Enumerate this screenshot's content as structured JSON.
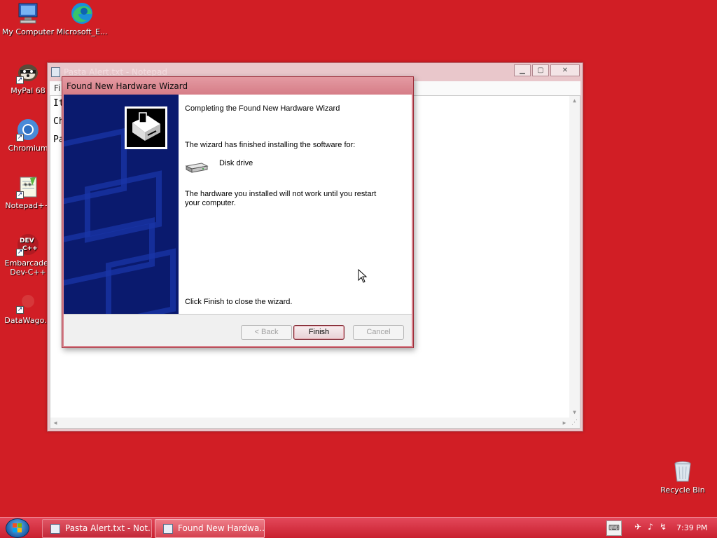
{
  "desktop": {
    "background": "#d11e25",
    "icons": [
      {
        "label": "My Computer",
        "icon": "computer-icon"
      },
      {
        "label": "Microsoft_E...",
        "icon": "edge-icon"
      },
      {
        "label": "MyPal 68",
        "icon": "mypal-icon"
      },
      {
        "label": "Chromium",
        "icon": "chromium-icon"
      },
      {
        "label": "Notepad++",
        "icon": "notepadpp-icon"
      },
      {
        "label": "Embarcader\nDev-C++",
        "icon": "devcpp-icon"
      },
      {
        "label": "DataWago...",
        "icon": "datawagon-icon"
      },
      {
        "label": "Recycle Bin",
        "icon": "recycle-bin-icon"
      }
    ]
  },
  "notepad": {
    "title": "Pasta Alert.txt - Notepad",
    "menu_first": "Fi",
    "lines": [
      "It",
      "Ch",
      "Pa"
    ]
  },
  "wizard": {
    "title": "Found New Hardware Wizard",
    "heading": "Completing the Found New Hardware Wizard",
    "finished_text": "The wizard has finished installing the software for:",
    "device_name": "Disk drive",
    "device_icon": "disk-drive-icon",
    "note": "The hardware you installed will not work until you restart your computer.",
    "closing": "Click Finish to close the wizard.",
    "buttons": {
      "back": "< Back",
      "finish": "Finish",
      "cancel": "Cancel"
    },
    "accent": "#0a1a6e"
  },
  "taskbar": {
    "tasks": [
      {
        "label": "Pasta Alert.txt - Not...",
        "active": false
      },
      {
        "label": "Found New Hardwa...",
        "active": true
      }
    ],
    "clock": "7:39 PM"
  }
}
